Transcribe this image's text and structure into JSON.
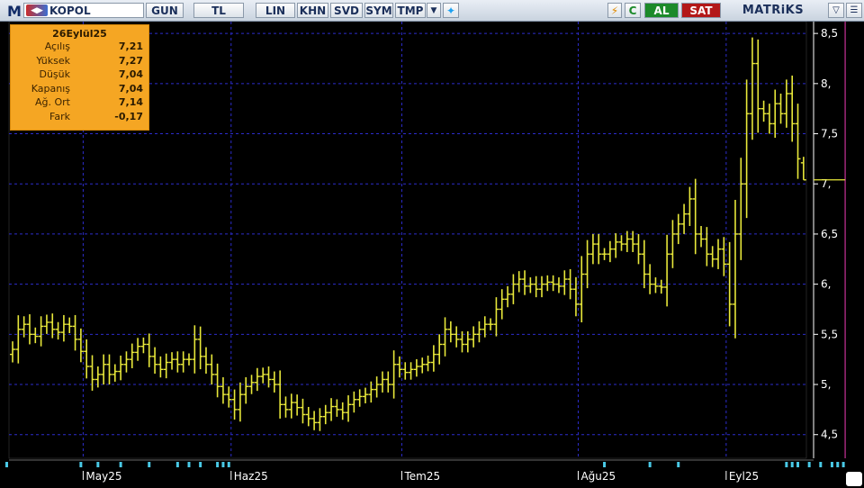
{
  "toolbar": {
    "logo": "M",
    "symbol": "KOPOL",
    "period": "GUN",
    "currency": "TL",
    "scale": "LIN",
    "buttons": [
      "KHN",
      "SVD",
      "SYM",
      "TMP"
    ],
    "refresh_label": "C",
    "buy_label": "AL",
    "sell_label": "SAT",
    "brand": "MATRiKS"
  },
  "info": {
    "date": "26Eylül25",
    "rows": [
      {
        "label": "Açılış",
        "value": "7,21"
      },
      {
        "label": "Yüksek",
        "value": "7,27"
      },
      {
        "label": "Düşük",
        "value": "7,04"
      },
      {
        "label": "Kapanış",
        "value": "7,04"
      },
      {
        "label": "Ağ. Ort",
        "value": "7,14"
      },
      {
        "label": "Fark",
        "value": "-0,17"
      }
    ]
  },
  "colors": {
    "bars": "#e8e83a",
    "grid": "#2c2ccc",
    "axis": "#ffffff",
    "cursor": "#a0287a",
    "info_bg": "#f5a623",
    "markers": "#49c9e6"
  },
  "chart_data": {
    "type": "ohlc",
    "title": "KOPOL",
    "ylim": [
      4.3,
      8.6
    ],
    "yticks": [
      4.5,
      5,
      5.5,
      6,
      6.5,
      7,
      7.5,
      8,
      8.5
    ],
    "ytick_labels": [
      "4,5",
      "5,",
      "5,5",
      "6,",
      "6,5",
      "7,",
      "7,5",
      "8,",
      "8,5"
    ],
    "x_labels": [
      {
        "label": "May25",
        "index": 13
      },
      {
        "label": "Haz25",
        "index": 39
      },
      {
        "label": "Tem25",
        "index": 69
      },
      {
        "label": "Ağu25",
        "index": 100
      },
      {
        "label": "Eyl25",
        "index": 126
      }
    ],
    "event_markers": [
      12,
      15,
      19,
      24,
      29,
      31,
      33,
      36,
      37,
      38,
      104,
      112,
      117,
      136,
      137,
      138,
      140,
      142,
      144,
      145,
      146
    ],
    "cursor_index": 146,
    "close": [
      5.35,
      5.55,
      5.6,
      5.5,
      5.48,
      5.58,
      5.62,
      5.55,
      5.52,
      5.6,
      5.58,
      5.45,
      5.33,
      5.18,
      5.05,
      5.1,
      5.2,
      5.1,
      5.13,
      5.2,
      5.25,
      5.32,
      5.38,
      5.4,
      5.28,
      5.2,
      5.15,
      5.22,
      5.25,
      5.2,
      5.25,
      5.25,
      5.45,
      5.28,
      5.2,
      5.1,
      4.98,
      4.9,
      4.85,
      4.75,
      4.9,
      4.98,
      5.02,
      5.08,
      5.1,
      5.05,
      5.0,
      4.8,
      4.75,
      4.82,
      4.77,
      4.7,
      4.66,
      4.62,
      4.68,
      4.72,
      4.78,
      4.75,
      4.72,
      4.8,
      4.85,
      4.88,
      4.9,
      4.95,
      5.0,
      5.05,
      5.0,
      5.2,
      5.15,
      5.12,
      5.15,
      5.18,
      5.2,
      5.22,
      5.3,
      5.4,
      5.55,
      5.5,
      5.45,
      5.4,
      5.45,
      5.5,
      5.55,
      5.6,
      5.6,
      5.75,
      5.85,
      5.9,
      6.0,
      6.05,
      5.98,
      6.0,
      5.95,
      6.0,
      6.02,
      6.0,
      5.98,
      6.05,
      5.95,
      5.8,
      6.1,
      6.3,
      6.4,
      6.3,
      6.3,
      6.35,
      6.42,
      6.4,
      6.45,
      6.4,
      6.3,
      6.1,
      6.0,
      5.98,
      5.97,
      6.3,
      6.5,
      6.6,
      6.7,
      6.85,
      6.5,
      6.45,
      6.3,
      6.25,
      6.35,
      6.2,
      5.8,
      6.5,
      7.0,
      7.7,
      8.2,
      7.75,
      7.7,
      7.6,
      7.8,
      7.7,
      7.9,
      7.6,
      7.25,
      7.04
    ]
  }
}
